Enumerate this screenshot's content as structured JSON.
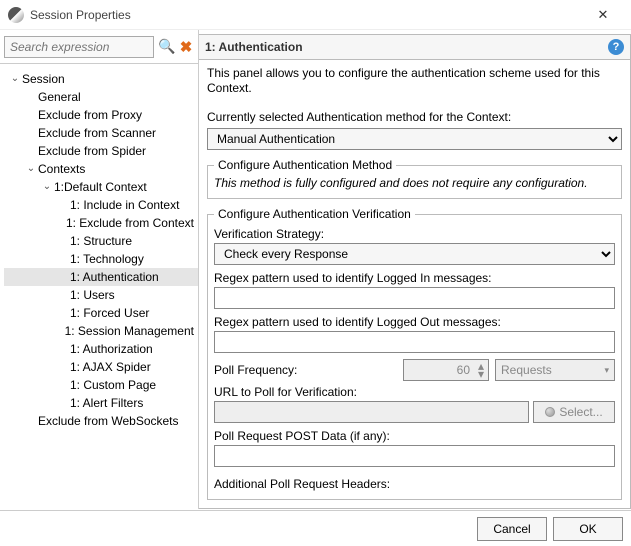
{
  "window": {
    "title": "Session Properties"
  },
  "search": {
    "placeholder": "Search expression"
  },
  "tree": {
    "root": "Session",
    "items": [
      "General",
      "Exclude from Proxy",
      "Exclude from Scanner",
      "Exclude from Spider"
    ],
    "contexts_label": "Contexts",
    "default_context": "1:Default Context",
    "context_children": [
      "1: Include in Context",
      "1: Exclude from Context",
      "1: Structure",
      "1: Technology",
      "1: Authentication",
      "1: Users",
      "1: Forced User",
      "1: Session Management",
      "1: Authorization",
      "1: AJAX Spider",
      "1: Custom Page",
      "1: Alert Filters"
    ],
    "websockets": "Exclude from WebSockets"
  },
  "panel": {
    "title": "1: Authentication",
    "desc": "This panel allows you to configure the authentication scheme used for this Context.",
    "method_label": "Currently selected Authentication method for the Context:",
    "method_value": "Manual Authentication",
    "fs_method_title": "Configure Authentication Method",
    "fs_method_note": "This method is fully configured and does not require any configuration.",
    "fs_verify_title": "Configure Authentication Verification",
    "strategy_label": "Verification Strategy:",
    "strategy_value": "Check every Response",
    "regex_in": "Regex pattern used to identify Logged In messages:",
    "regex_out": "Regex pattern used to identify Logged Out messages:",
    "poll_freq": "Poll Frequency:",
    "poll_value": "60",
    "poll_unit": "Requests",
    "url_label": "URL to Poll for Verification:",
    "select_btn": "Select...",
    "post_label": "Poll Request POST Data (if any):",
    "add_headers": "Additional Poll Request Headers:"
  },
  "footer": {
    "cancel": "Cancel",
    "ok": "OK"
  }
}
